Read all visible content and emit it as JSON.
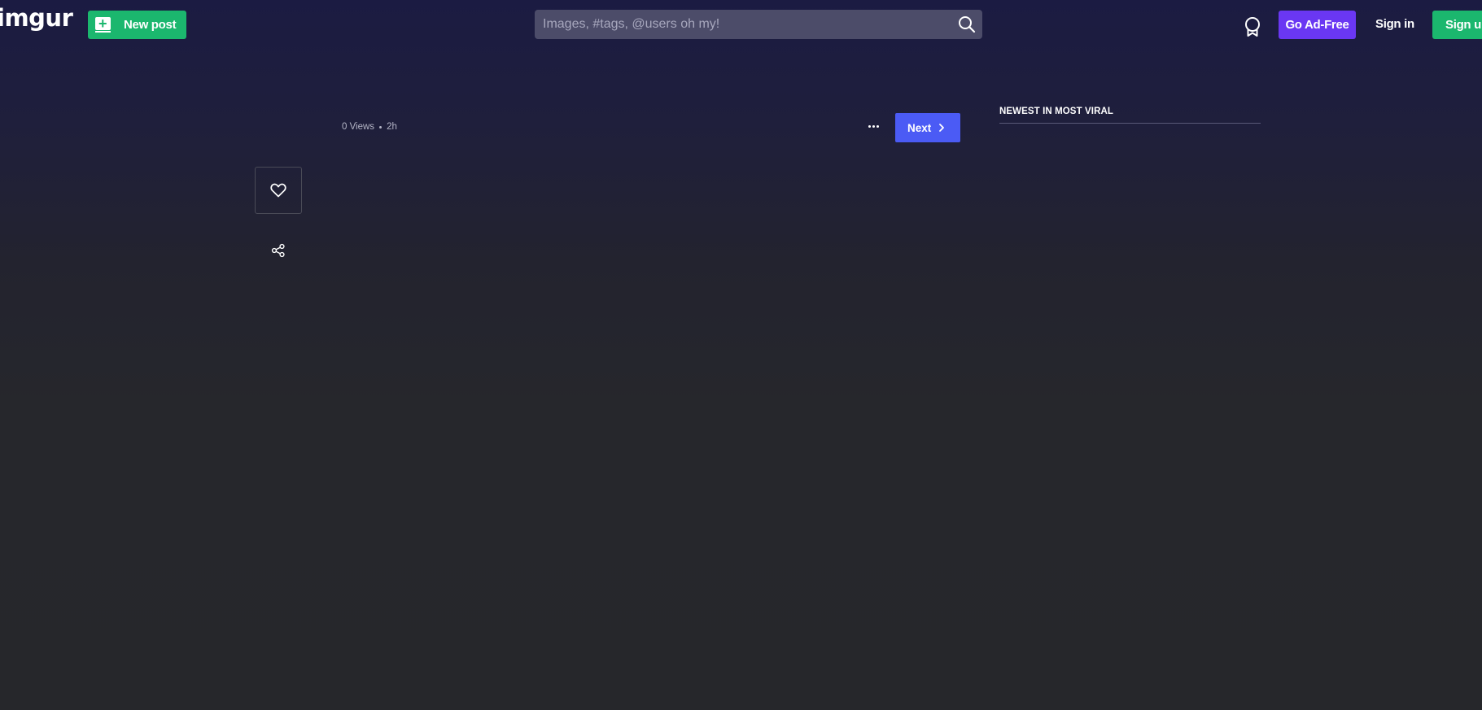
{
  "header": {
    "logo_text": "imgur",
    "new_post_label": "New post",
    "search": {
      "placeholder": "Images, #tags, @users oh my!",
      "value": ""
    },
    "go_ad_free_label": "Go Ad-Free",
    "sign_in_label": "Sign in",
    "sign_up_label": "Sign up",
    "icons": {
      "new_post": "plus-box-icon",
      "search": "search-icon",
      "award": "award-ribbon-icon"
    },
    "colors": {
      "green": "#1bb76e",
      "purple": "#6a37f3",
      "search_bg": "#4c4c69"
    }
  },
  "post": {
    "views": "0 Views",
    "age": "2h",
    "next_label": "Next",
    "next_color": "#4b5bf5",
    "icons": {
      "more": "ellipsis-icon",
      "next": "chevron-right-icon",
      "like": "heart-icon",
      "share": "share-icon"
    }
  },
  "sidebar": {
    "title": "NEWEST IN MOST VIRAL"
  }
}
